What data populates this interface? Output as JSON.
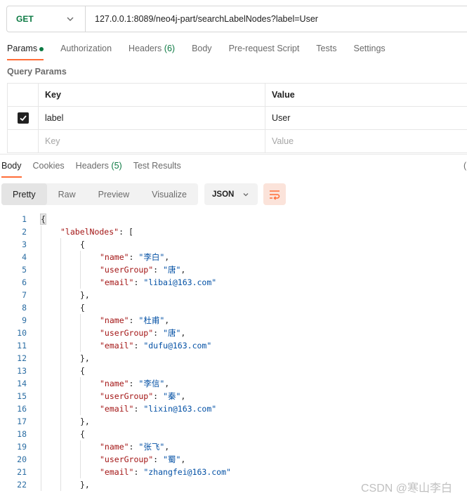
{
  "request": {
    "method": "GET",
    "url": "127.0.0.1:8089/neo4j-part/searchLabelNodes?label=User"
  },
  "request_tabs": [
    {
      "label": "Params",
      "active": true,
      "dot": true
    },
    {
      "label": "Authorization"
    },
    {
      "label": "Headers",
      "count": "(6)"
    },
    {
      "label": "Body"
    },
    {
      "label": "Pre-request Script"
    },
    {
      "label": "Tests"
    },
    {
      "label": "Settings"
    }
  ],
  "query_params": {
    "title": "Query Params",
    "headers": {
      "key": "Key",
      "value": "Value"
    },
    "rows": [
      {
        "checked": true,
        "key": "label",
        "value": "User"
      }
    ],
    "empty_row": {
      "key_placeholder": "Key",
      "value_placeholder": "Value"
    }
  },
  "response_tabs": [
    {
      "label": "Body",
      "active": true
    },
    {
      "label": "Cookies"
    },
    {
      "label": "Headers",
      "count": "(5)"
    },
    {
      "label": "Test Results"
    }
  ],
  "view_modes": [
    {
      "label": "Pretty",
      "active": true
    },
    {
      "label": "Raw"
    },
    {
      "label": "Preview"
    },
    {
      "label": "Visualize"
    }
  ],
  "format": "JSON",
  "code_lines": [
    {
      "n": "1",
      "indent": 0,
      "parts": [
        {
          "c": "p",
          "t": "{"
        }
      ]
    },
    {
      "n": "2",
      "indent": 1,
      "parts": [
        {
          "c": "k",
          "t": "\"labelNodes\""
        },
        {
          "c": "p",
          "t": ": ["
        }
      ]
    },
    {
      "n": "3",
      "indent": 2,
      "parts": [
        {
          "c": "p",
          "t": "{"
        }
      ]
    },
    {
      "n": "4",
      "indent": 3,
      "parts": [
        {
          "c": "k",
          "t": "\"name\""
        },
        {
          "c": "p",
          "t": ": "
        },
        {
          "c": "s",
          "t": "\"李白\""
        },
        {
          "c": "p",
          "t": ","
        }
      ]
    },
    {
      "n": "5",
      "indent": 3,
      "parts": [
        {
          "c": "k",
          "t": "\"userGroup\""
        },
        {
          "c": "p",
          "t": ": "
        },
        {
          "c": "s",
          "t": "\"唐\""
        },
        {
          "c": "p",
          "t": ","
        }
      ]
    },
    {
      "n": "6",
      "indent": 3,
      "parts": [
        {
          "c": "k",
          "t": "\"email\""
        },
        {
          "c": "p",
          "t": ": "
        },
        {
          "c": "s",
          "t": "\"libai@163.com\""
        }
      ]
    },
    {
      "n": "7",
      "indent": 2,
      "parts": [
        {
          "c": "p",
          "t": "},"
        }
      ]
    },
    {
      "n": "8",
      "indent": 2,
      "parts": [
        {
          "c": "p",
          "t": "{"
        }
      ]
    },
    {
      "n": "9",
      "indent": 3,
      "parts": [
        {
          "c": "k",
          "t": "\"name\""
        },
        {
          "c": "p",
          "t": ": "
        },
        {
          "c": "s",
          "t": "\"杜甫\""
        },
        {
          "c": "p",
          "t": ","
        }
      ]
    },
    {
      "n": "10",
      "indent": 3,
      "parts": [
        {
          "c": "k",
          "t": "\"userGroup\""
        },
        {
          "c": "p",
          "t": ": "
        },
        {
          "c": "s",
          "t": "\"唐\""
        },
        {
          "c": "p",
          "t": ","
        }
      ]
    },
    {
      "n": "11",
      "indent": 3,
      "parts": [
        {
          "c": "k",
          "t": "\"email\""
        },
        {
          "c": "p",
          "t": ": "
        },
        {
          "c": "s",
          "t": "\"dufu@163.com\""
        }
      ]
    },
    {
      "n": "12",
      "indent": 2,
      "parts": [
        {
          "c": "p",
          "t": "},"
        }
      ]
    },
    {
      "n": "13",
      "indent": 2,
      "parts": [
        {
          "c": "p",
          "t": "{"
        }
      ]
    },
    {
      "n": "14",
      "indent": 3,
      "parts": [
        {
          "c": "k",
          "t": "\"name\""
        },
        {
          "c": "p",
          "t": ": "
        },
        {
          "c": "s",
          "t": "\"李信\""
        },
        {
          "c": "p",
          "t": ","
        }
      ]
    },
    {
      "n": "15",
      "indent": 3,
      "parts": [
        {
          "c": "k",
          "t": "\"userGroup\""
        },
        {
          "c": "p",
          "t": ": "
        },
        {
          "c": "s",
          "t": "\"秦\""
        },
        {
          "c": "p",
          "t": ","
        }
      ]
    },
    {
      "n": "16",
      "indent": 3,
      "parts": [
        {
          "c": "k",
          "t": "\"email\""
        },
        {
          "c": "p",
          "t": ": "
        },
        {
          "c": "s",
          "t": "\"lixin@163.com\""
        }
      ]
    },
    {
      "n": "17",
      "indent": 2,
      "parts": [
        {
          "c": "p",
          "t": "},"
        }
      ]
    },
    {
      "n": "18",
      "indent": 2,
      "parts": [
        {
          "c": "p",
          "t": "{"
        }
      ]
    },
    {
      "n": "19",
      "indent": 3,
      "parts": [
        {
          "c": "k",
          "t": "\"name\""
        },
        {
          "c": "p",
          "t": ": "
        },
        {
          "c": "s",
          "t": "\"张飞\""
        },
        {
          "c": "p",
          "t": ","
        }
      ]
    },
    {
      "n": "20",
      "indent": 3,
      "parts": [
        {
          "c": "k",
          "t": "\"userGroup\""
        },
        {
          "c": "p",
          "t": ": "
        },
        {
          "c": "s",
          "t": "\"蜀\""
        },
        {
          "c": "p",
          "t": ","
        }
      ]
    },
    {
      "n": "21",
      "indent": 3,
      "parts": [
        {
          "c": "k",
          "t": "\"email\""
        },
        {
          "c": "p",
          "t": ": "
        },
        {
          "c": "s",
          "t": "\"zhangfei@163.com\""
        }
      ]
    },
    {
      "n": "22",
      "indent": 2,
      "parts": [
        {
          "c": "p",
          "t": "},"
        }
      ]
    }
  ],
  "watermark": "CSDN @寒山李白",
  "colors": {
    "accent": "#ff6c37",
    "method_get": "#0c7a43",
    "json_key": "#a31515",
    "json_string": "#0451a5",
    "line_number": "#2b6da3"
  }
}
